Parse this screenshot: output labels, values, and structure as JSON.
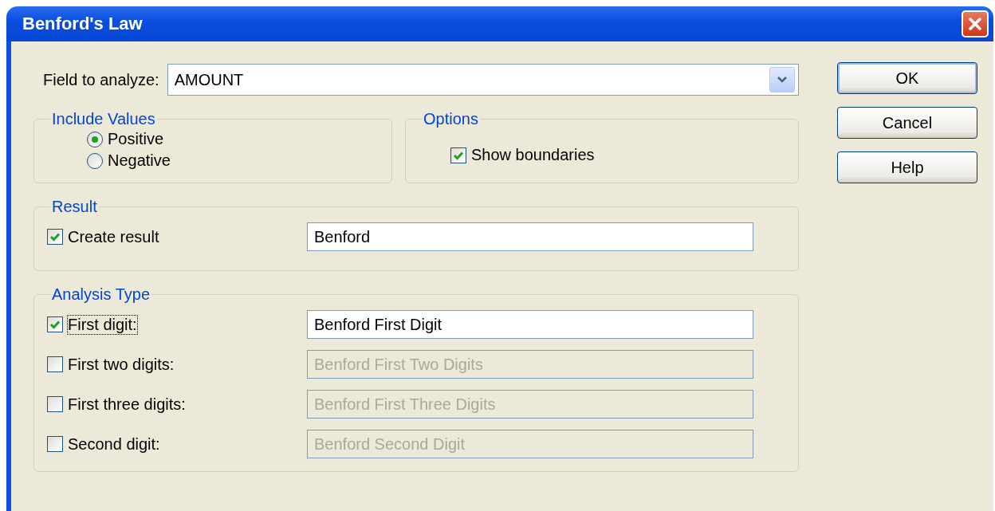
{
  "window": {
    "title": "Benford's Law"
  },
  "field": {
    "label": "Field to analyze:",
    "value": "AMOUNT"
  },
  "include_values": {
    "title": "Include Values",
    "options": [
      {
        "label": "Positive",
        "selected": true
      },
      {
        "label": "Negative",
        "selected": false
      }
    ]
  },
  "options": {
    "title": "Options",
    "items": [
      {
        "label": "Show boundaries",
        "checked": true
      }
    ]
  },
  "result": {
    "title": "Result",
    "label": "Create result",
    "checked": true,
    "value": "Benford"
  },
  "analysis_type": {
    "title": "Analysis Type",
    "items": [
      {
        "label": "First digit:",
        "checked": true,
        "focused": true,
        "value": "Benford First Digit",
        "disabled": false
      },
      {
        "label": "First two digits:",
        "checked": false,
        "focused": false,
        "value": "Benford First Two Digits",
        "disabled": true
      },
      {
        "label": "First three digits:",
        "checked": false,
        "focused": false,
        "value": "Benford First Three Digits",
        "disabled": true
      },
      {
        "label": "Second digit:",
        "checked": false,
        "focused": false,
        "value": "Benford Second Digit",
        "disabled": true
      }
    ]
  },
  "buttons": [
    {
      "label": "OK",
      "default": true
    },
    {
      "label": "Cancel",
      "default": false
    },
    {
      "label": "Help",
      "default": false
    }
  ]
}
